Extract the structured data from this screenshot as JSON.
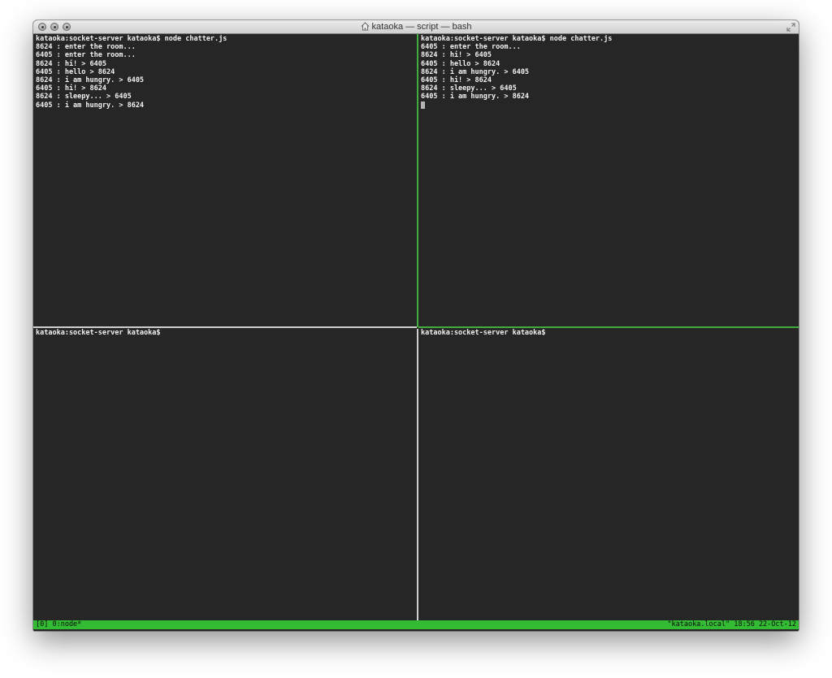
{
  "window": {
    "title": "kataoka — script — bash"
  },
  "panes": {
    "top_left": {
      "lines": [
        "kataoka:socket-server kataoka$ node chatter.js",
        "8624 : enter the room...",
        "6405 : enter the room...",
        "8624 : hi! > 6405",
        "6405 : hello > 8624",
        "8624 : i am hungry. > 6405",
        "6405 : hi! > 8624",
        "8624 : sleepy... > 6405",
        "6405 : i am hungry. > 8624"
      ]
    },
    "top_right": {
      "lines": [
        "kataoka:socket-server kataoka$ node chatter.js",
        "6405 : enter the room...",
        "8624 : hi! > 6405",
        "6405 : hello > 8624",
        "8624 : i am hungry. > 6405",
        "6405 : hi! > 8624",
        "8624 : sleepy... > 6405",
        "6405 : i am hungry. > 8624"
      ]
    },
    "bottom_left": {
      "lines": [
        "kataoka:socket-server kataoka$"
      ]
    },
    "bottom_right": {
      "lines": [
        "kataoka:socket-server kataoka$"
      ]
    }
  },
  "statusbar": {
    "left": "[0] 0:node*",
    "right": "\"kataoka.local\" 18:56 22-Oct-12"
  },
  "colors": {
    "terminal_bg": "#262626",
    "terminal_fg": "#f2f2f2",
    "active_border": "#3fae3f",
    "inactive_border": "#cfcfcf",
    "status_bg": "#33bb33"
  }
}
